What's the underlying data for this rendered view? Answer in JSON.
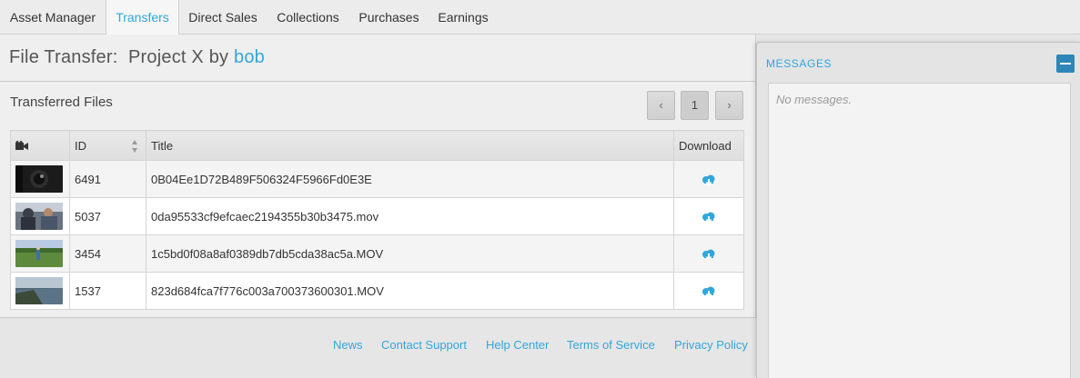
{
  "nav": {
    "tabs": [
      {
        "label": "Asset Manager",
        "active": false
      },
      {
        "label": "Transfers",
        "active": true
      },
      {
        "label": "Direct Sales",
        "active": false
      },
      {
        "label": "Collections",
        "active": false
      },
      {
        "label": "Purchases",
        "active": false
      },
      {
        "label": "Earnings",
        "active": false
      }
    ]
  },
  "page": {
    "title_prefix": "File Transfer:  Project X by ",
    "owner": "bob"
  },
  "section": {
    "title": "Transferred Files"
  },
  "pager": {
    "prev_label": "‹",
    "current_page": "1",
    "next_label": "›"
  },
  "table": {
    "columns": {
      "thumb_icon": "video-camera-icon",
      "id": "ID",
      "title": "Title",
      "download": "Download"
    },
    "rows": [
      {
        "id": "6491",
        "title": "0B04Ee1D72B489F506324F5966Fd0E3E",
        "thumb": "dark-lens-thumbnail"
      },
      {
        "id": "5037",
        "title": "0da95533cf9efcaec2194355b30b3475.mov",
        "thumb": "people-outdoor-thumbnail"
      },
      {
        "id": "3454",
        "title": "1c5bd0f08a8af0389db7db5cda38ac5a.MOV",
        "thumb": "field-person-thumbnail"
      },
      {
        "id": "1537",
        "title": "823d684fca7f776c003a700373600301.MOV",
        "thumb": "coastline-thumbnail"
      }
    ]
  },
  "footer": {
    "links": [
      "News",
      "Contact Support",
      "Help Center",
      "Terms of Service",
      "Privacy Policy"
    ]
  },
  "messages": {
    "title": "MESSAGES",
    "empty_text": "No messages."
  },
  "colors": {
    "accent": "#33a6d9",
    "collapse_button": "#2e86b8"
  }
}
